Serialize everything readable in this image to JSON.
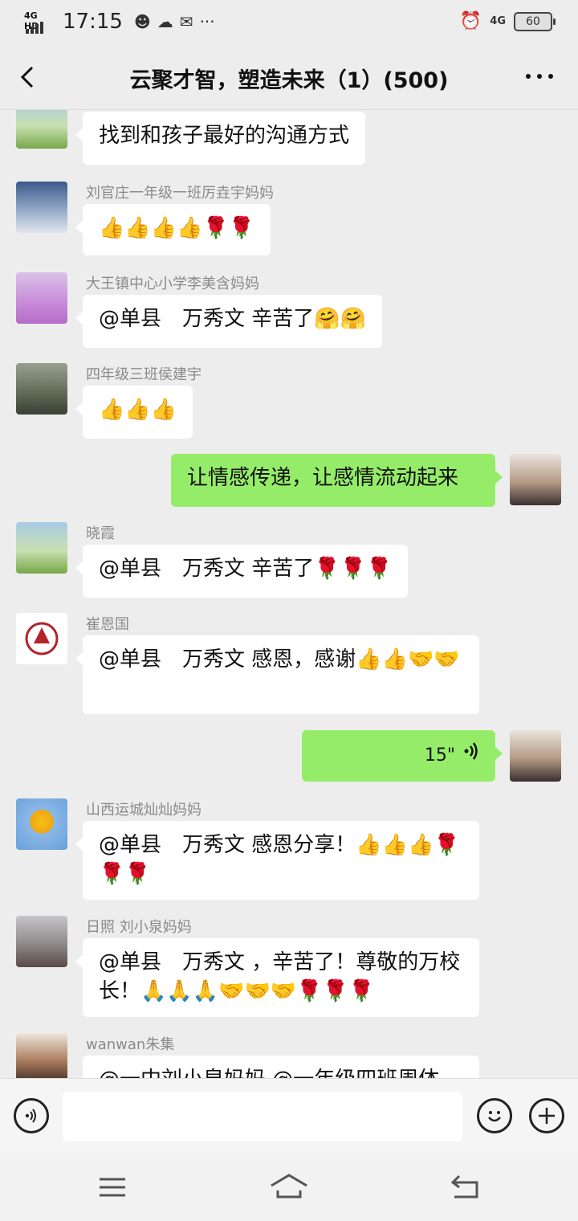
{
  "status_bar": {
    "network_left": "4G HD",
    "time": "17:15",
    "network_right": "4G",
    "battery": "60"
  },
  "header": {
    "title": "云聚才智，塑造未来（1）(500)"
  },
  "messages": [
    {
      "sender": "",
      "text": "找到和孩子最好的沟通方式",
      "side": "left"
    },
    {
      "sender": "刘官庄一年级一班厉垚宇妈妈",
      "text": "👍👍👍👍🌹🌹",
      "side": "left"
    },
    {
      "sender": "大王镇中心小学李美含妈妈",
      "text": "@单县　万秀文  辛苦了🤗🤗",
      "side": "left"
    },
    {
      "sender": "四年级三班侯建宇",
      "text": "👍👍👍",
      "side": "left"
    },
    {
      "sender": "",
      "text": "让情感传递，让感情流动起来",
      "side": "right"
    },
    {
      "sender": "晓霞",
      "text": "@单县　万秀文  辛苦了🌹🌹🌹",
      "side": "left"
    },
    {
      "sender": "崔恩国",
      "text": "@单县　万秀文  感恩，感谢👍👍🤝🤝",
      "side": "left"
    },
    {
      "sender": "",
      "text": "15\"",
      "side": "right",
      "type": "voice"
    },
    {
      "sender": "山西运城灿灿妈妈",
      "text": "@单县　万秀文  感恩分享！👍👍👍🌹🌹🌹",
      "side": "left"
    },
    {
      "sender": "日照  刘小泉妈妈",
      "text": "@单县　万秀文 ，辛苦了！尊敬的万校长！🙏🙏🙏🤝🤝🤝🌹🌹🌹",
      "side": "left"
    },
    {
      "sender": "wanwan朱集",
      "text": "@一中刘小泉妈妈 @一年级四班周体",
      "side": "left"
    }
  ],
  "colors": {
    "background": "#ededed",
    "bubble_self": "#95ec69",
    "bubble_other": "#ffffff",
    "sender_text": "#8a8a8a"
  },
  "icons": {
    "back": "back-chevron-icon",
    "more": "more-dots-icon",
    "voice": "voice-input-icon",
    "emoji": "emoji-icon",
    "plus": "plus-icon",
    "sys_menu": "menu-icon",
    "sys_home": "home-icon",
    "sys_back": "back-icon"
  }
}
